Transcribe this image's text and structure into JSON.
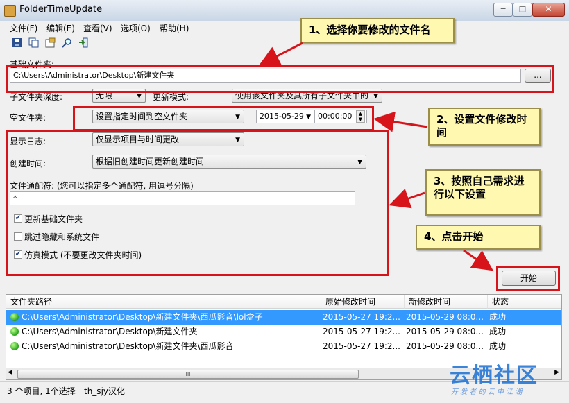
{
  "window": {
    "title": "FolderTimeUpdate",
    "minimize": "─",
    "maximize": "□",
    "close": "✕"
  },
  "menu": [
    "文件(F)",
    "编辑(E)",
    "查看(V)",
    "选项(O)",
    "帮助(H)"
  ],
  "toolbar_icons": [
    "save-icon",
    "copy-icon",
    "properties-icon",
    "find-icon",
    "exit-icon"
  ],
  "base_folder": {
    "label": "基础文件夹:",
    "value": "C:\\Users\\Administrator\\Desktop\\新建文件夹",
    "browse": "..."
  },
  "subfolder_depth": {
    "label": "子文件夹深度:",
    "value": "无限"
  },
  "update_mode": {
    "label": "更新模式:",
    "value": "使用该文件夹及其所有子文件夹中的"
  },
  "empty_folder": {
    "label": "空文件夹:",
    "value": "设置指定时间到空文件夹",
    "date": "2015-05-29",
    "time": "00:00:00"
  },
  "show_log": {
    "label": "显示日志:",
    "value": "仅显示项目与时间更改"
  },
  "created_time": {
    "label": "创建时间:",
    "value": "根据旧创建时间更新创建时间"
  },
  "wildcard": {
    "label": "文件通配符: (您可以指定多个通配符, 用逗号分隔)",
    "value": "*"
  },
  "checkboxes": [
    {
      "label": "更新基础文件夹",
      "checked": true
    },
    {
      "label": "跳过隐藏和系统文件",
      "checked": false
    },
    {
      "label": "仿真模式 (不要更改文件夹时间)",
      "checked": true
    }
  ],
  "start_button": "开始",
  "callouts": [
    "1、选择你要修改的文件名",
    "2、设置文件修改时间",
    "3、按照自己需求进行以下设置",
    "4、点击开始"
  ],
  "list": {
    "columns": [
      "文件夹路径",
      "原始修改时间",
      "新修改时间",
      "状态"
    ],
    "rows": [
      {
        "path": "C:\\Users\\Administrator\\Desktop\\新建文件夹\\西瓜影音\\lol盒子",
        "orig": "2015-05-27 19:2...",
        "new": "2015-05-29 08:0...",
        "status": "成功",
        "selected": true
      },
      {
        "path": "C:\\Users\\Administrator\\Desktop\\新建文件夹",
        "orig": "2015-05-27 19:2...",
        "new": "2015-05-29 08:0...",
        "status": "成功",
        "selected": false
      },
      {
        "path": "C:\\Users\\Administrator\\Desktop\\新建文件夹\\西瓜影音",
        "orig": "2015-05-27 19:2...",
        "new": "2015-05-29 08:0...",
        "status": "成功",
        "selected": false
      }
    ],
    "scroll_grip": "III"
  },
  "status": {
    "items": "3 个项目, 1个选择",
    "credit": "th_sjy汉化"
  },
  "watermark": {
    "title": "云栖社区",
    "subtitle": "开 发 者 的 云 中 江 湖"
  },
  "colors": {
    "annotation_red": "#d7141a",
    "callout_bg": "#fff8b0",
    "selection": "#3399ff"
  }
}
